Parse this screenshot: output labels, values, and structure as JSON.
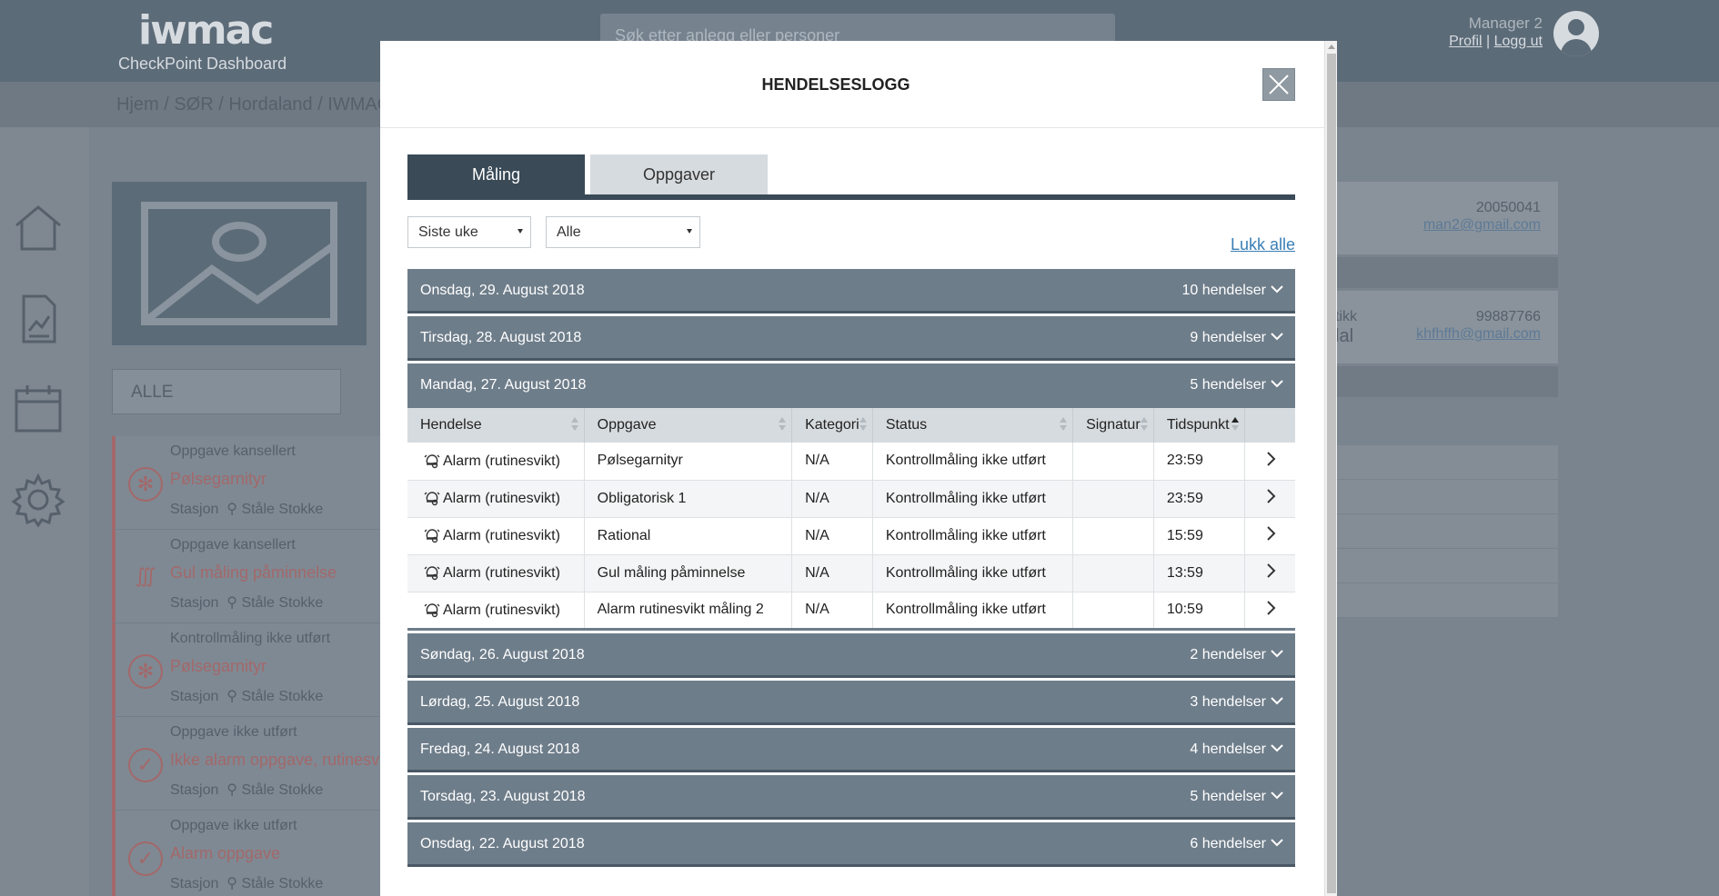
{
  "app": {
    "logo_text": "iwmac",
    "subtitle": "CheckPoint Dashboard",
    "search_placeholder": "Søk etter anlegg eller personer",
    "user": {
      "name": "Manager 2",
      "profile_link": "Profil",
      "separator": "|",
      "logout_link": "Logg ut"
    },
    "breadcrumb": "Hjem / SØR / Hordaland / IWMAC"
  },
  "background": {
    "filter_value": "ALLE",
    "tasks": [
      {
        "status": "Oppgave kansellert",
        "title": "Pølsegarnityr",
        "station": "Stasjon",
        "person": "Ståle Stokke",
        "icon": "snowflake-icon"
      },
      {
        "status": "Oppgave kansellert",
        "title": "Gul måling påminnelse",
        "station": "Stasjon",
        "person": "Ståle Stokke",
        "icon": "heat-icon"
      },
      {
        "status": "Kontrollmåling ikke utført",
        "title": "Pølsegarnityr",
        "station": "Stasjon",
        "person": "Ståle Stokke",
        "icon": "snowflake-icon"
      },
      {
        "status": "Oppgave ikke utført",
        "title": "Ikke alarm oppgave, rutinesvi",
        "station": "Stasjon",
        "person": "Ståle Stokke",
        "icon": "check-icon"
      },
      {
        "status": "Oppgave ikke utført",
        "title": "Alarm oppgave",
        "station": "Stasjon",
        "person": "Ståle Stokke",
        "icon": "check-icon"
      }
    ],
    "right_panel": {
      "number_1": "20050041",
      "email_1": "man2@gmail.com",
      "fragment_1": "tikk",
      "fragment_2": "lal",
      "number_2": "99887766",
      "email_2": "khfhffh@gmail.com"
    }
  },
  "modal": {
    "title": "HENDELSESLOGG",
    "tabs": [
      {
        "label": "Måling",
        "active": true
      },
      {
        "label": "Oppgaver",
        "active": false
      }
    ],
    "filters": {
      "period": "Siste uke",
      "type": "Alle"
    },
    "close_all": "Lukk alle",
    "days_before": [
      {
        "label": "Onsdag, 29. August 2018",
        "count": "10 hendelser"
      },
      {
        "label": "Tirsdag, 28. August 2018",
        "count": "9 hendelser"
      }
    ],
    "expanded_day": {
      "label": "Mandag, 27. August 2018",
      "count": "5 hendelser"
    },
    "table": {
      "headers": [
        "Hendelse",
        "Oppgave",
        "Kategori",
        "Status",
        "Signatur",
        "Tidspunkt"
      ],
      "sorted_column": "Tidspunkt",
      "rows": [
        {
          "event": "Alarm (rutinesvikt)",
          "task": "Pølsegarnityr",
          "category": "N/A",
          "status": "Kontrollmåling ikke utført",
          "signature": "",
          "time": "23:59"
        },
        {
          "event": "Alarm (rutinesvikt)",
          "task": "Obligatorisk 1",
          "category": "N/A",
          "status": "Kontrollmåling ikke utført",
          "signature": "",
          "time": "23:59"
        },
        {
          "event": "Alarm (rutinesvikt)",
          "task": "Rational",
          "category": "N/A",
          "status": "Kontrollmåling ikke utført",
          "signature": "",
          "time": "15:59"
        },
        {
          "event": "Alarm (rutinesvikt)",
          "task": "Gul måling påminnelse",
          "category": "N/A",
          "status": "Kontrollmåling ikke utført",
          "signature": "",
          "time": "13:59"
        },
        {
          "event": "Alarm (rutinesvikt)",
          "task": "Alarm rutinesvikt måling 2",
          "category": "N/A",
          "status": "Kontrollmåling ikke utført",
          "signature": "",
          "time": "10:59"
        }
      ]
    },
    "days_after": [
      {
        "label": "Søndag, 26. August 2018",
        "count": "2 hendelser"
      },
      {
        "label": "Lørdag, 25. August 2018",
        "count": "3 hendelser"
      },
      {
        "label": "Fredag, 24. August 2018",
        "count": "4 hendelser"
      },
      {
        "label": "Torsdag, 23. August 2018",
        "count": "5 hendelser"
      },
      {
        "label": "Onsdag, 22. August 2018",
        "count": "6 hendelser"
      }
    ]
  },
  "colors": {
    "tab_active": "#3a4a57",
    "day_header": "#6e7d8a",
    "link": "#3a7fb5",
    "alert_red": "#a3686a"
  }
}
